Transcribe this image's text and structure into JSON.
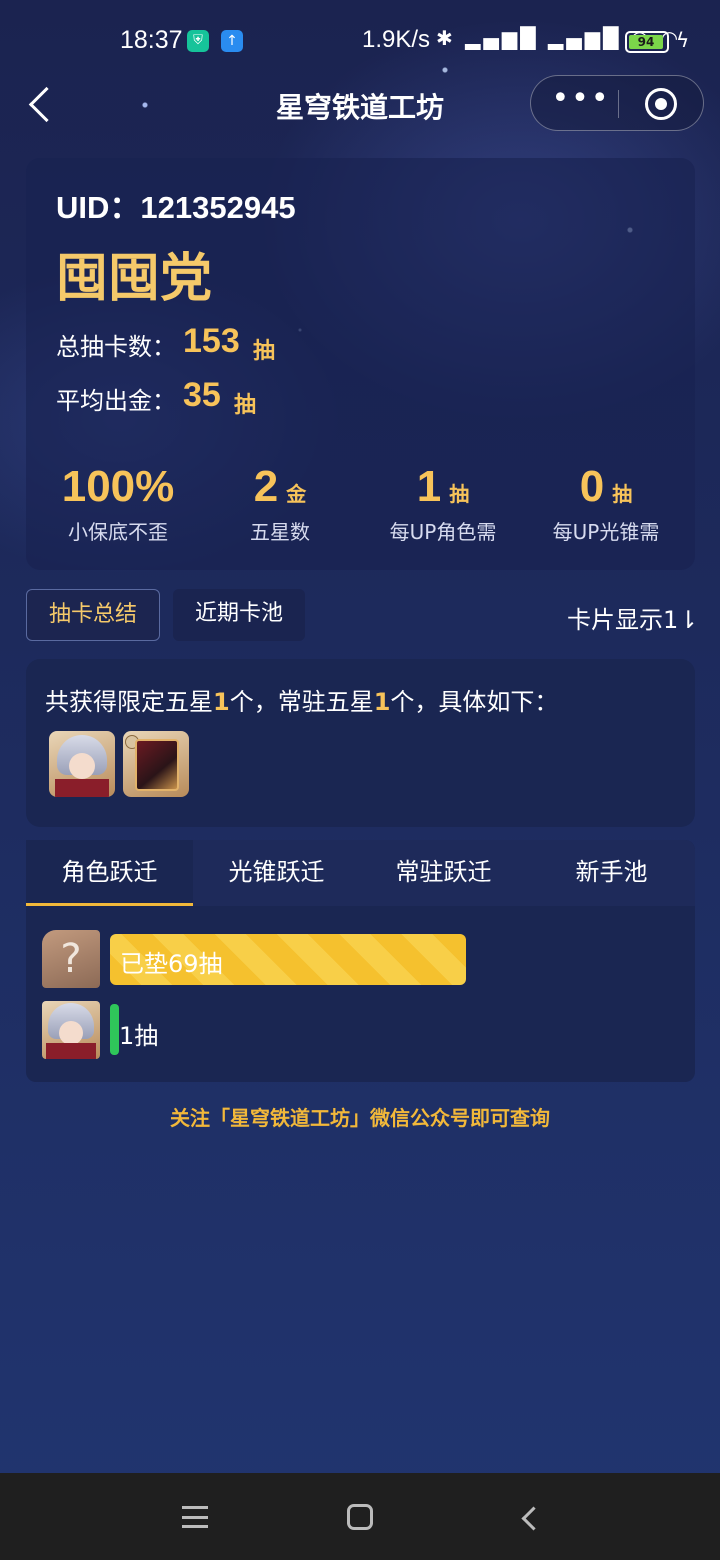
{
  "status_bar": {
    "time": "18:37",
    "net_speed": "1.9K/s",
    "battery": "94",
    "icons": [
      "shield-app-icon",
      "upload-app-icon",
      "bluetooth-icon",
      "signal-hd-icon",
      "signal-hd-icon",
      "wifi-icon",
      "wifi-icon",
      "battery-icon",
      "charging-icon"
    ]
  },
  "header": {
    "title": "星穹铁道工坊",
    "more_label": "•••"
  },
  "profile": {
    "uid_label": "UID：121352945",
    "nickname": "囤囤党",
    "total_pulls_label": "总抽卡数：",
    "total_pulls_value": "153",
    "total_pulls_unit": "抽",
    "avg_gold_label": "平均出金：",
    "avg_gold_value": "35",
    "avg_gold_unit": "抽"
  },
  "stats": [
    {
      "value": "100%",
      "unit": "",
      "caption": "小保底不歪"
    },
    {
      "value": "2",
      "unit": "金",
      "caption": "五星数"
    },
    {
      "value": "1",
      "unit": "抽",
      "caption": "每UP角色需"
    },
    {
      "value": "0",
      "unit": "抽",
      "caption": "每UP光锥需"
    }
  ],
  "summary_tabs": {
    "active": "抽卡总结",
    "inactive": "近期卡池",
    "card_display": "卡片显示1⇂"
  },
  "obtained": {
    "prefix": "共获得限定五星",
    "limited_count": "1",
    "middle": "个，常驻五星",
    "standard_count": "1",
    "suffix": "个，具体如下："
  },
  "pool_tabs": [
    "角色跃迁",
    "光锥跃迁",
    "常驻跃迁",
    "新手池"
  ],
  "pity": {
    "unknown_symbol": "?",
    "pending_label": "已垫69抽",
    "pending_pulls": 69,
    "char_pull_label": "1抽",
    "char_pulls": 1
  },
  "footer": {
    "note": "关注「星穹铁道工坊」微信公众号即可查询"
  },
  "colors": {
    "accent_gold": "#f7c35a",
    "bar_yellow": "#f5c12e",
    "bar_green": "#2fc65a",
    "background": "#1d2a5c"
  }
}
